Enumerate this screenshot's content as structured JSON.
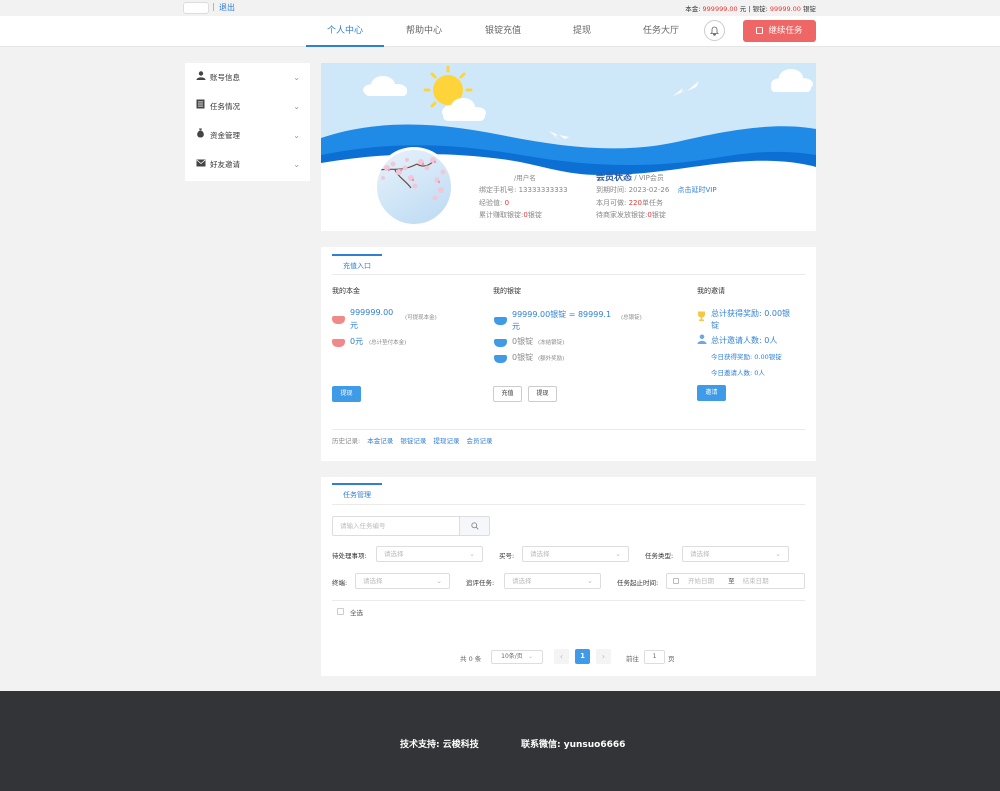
{
  "topbar": {
    "separator": "|",
    "logout": "退出",
    "principal_label": "本金:",
    "principal_value": "999999.00",
    "principal_unit": "元",
    "divider": "|",
    "ingot_label": "银锭:",
    "ingot_value": "99999.00",
    "ingot_unit": "银锭"
  },
  "nav": {
    "items": [
      "个人中心",
      "帮助中心",
      "银锭充值",
      "提现",
      "任务大厅"
    ],
    "active_index": 0,
    "bell_icon": "bell-icon",
    "continue_task": "继续任务"
  },
  "sidebar": {
    "items": [
      {
        "label": "账号信息",
        "icon": "user-icon"
      },
      {
        "label": "任务情况",
        "icon": "list-icon"
      },
      {
        "label": "资金管理",
        "icon": "money-bag-icon"
      },
      {
        "label": "好友邀请",
        "icon": "mail-icon"
      }
    ]
  },
  "profile": {
    "username": "/用户名",
    "phone_label": "绑定手机号:",
    "phone_value": "13333333333",
    "exp_label": "经验值:",
    "exp_value": "0",
    "earned_label": "累计赚取银锭:",
    "earned_value": "0",
    "earned_unit": "银锭",
    "member_status": "会员状态",
    "member_type": "/ VIP会员",
    "expire_label": "到期时间:",
    "expire_value": "2023-02-26",
    "renew_link": "点击延时VIP",
    "monthly_label": "本月可做:",
    "monthly_value": "220",
    "monthly_unit": "单任务",
    "pending_label": "待商家发放银锭:",
    "pending_value": "0",
    "pending_unit": "银锭"
  },
  "recharge": {
    "tab": "充值入口",
    "principal": {
      "title": "我的本金",
      "amount1": "999999.00",
      "amount1_unit": "元",
      "amount1_note": "(可提现本金)",
      "amount2": "0元",
      "amount2_note": "(总计垫付本金)",
      "withdraw_button": "提现"
    },
    "ingot": {
      "title": "我的银锭",
      "amount1": "99999.00银锭 = 89999.1",
      "amount1_unit": "元",
      "amount1_note": "(总银锭)",
      "amount2": "0银锭",
      "amount2_note": "(冻结银锭)",
      "amount3": "0银锭",
      "amount3_note": "(额外奖励)",
      "recharge_button": "充值",
      "withdraw_button": "提现"
    },
    "invite": {
      "title": "我的邀请",
      "total_reward": "总计获得奖励: 0.00银",
      "total_reward_unit": "锭",
      "total_invites": "总计邀请人数: 0人",
      "today_reward": "今日获得奖励: 0.00银锭",
      "today_invites": "今日邀请人数: 0人",
      "invite_button": "邀请"
    },
    "history": {
      "label": "历史记录:",
      "links": [
        "本金记录",
        "银锭记录",
        "提现记录",
        "会员记录"
      ]
    }
  },
  "task": {
    "tab": "任务管理",
    "search_placeholder": "请输入任务编号",
    "search_icon": "search-icon",
    "filters": {
      "pending_label": "待处理事项:",
      "pending_placeholder": "请选择",
      "buyer_label": "买号:",
      "buyer_placeholder": "请选择",
      "type_label": "任务类型:",
      "type_placeholder": "请选择",
      "terminal_label": "终端:",
      "terminal_placeholder": "请选择",
      "review_label": "追评任务:",
      "review_placeholder": "请选择",
      "time_label": "任务起止时间:",
      "start_placeholder": "开始日期",
      "range_sep": "至",
      "end_placeholder": "结束日期"
    },
    "select_all": "全选",
    "pager": {
      "total": "共 0 条",
      "page_size": "10条/页",
      "current_page": "1",
      "goto_label": "前往",
      "goto_value": "1",
      "goto_unit": "页"
    }
  },
  "footer": {
    "support": "技术支持: 云梭科技",
    "wechat": "联系微信: yunsuo6666"
  },
  "colors": {
    "accent": "#2f7fd6",
    "button_blue": "#3f9ae8",
    "task_button": "#ee6666",
    "footer_bg": "#323437"
  }
}
